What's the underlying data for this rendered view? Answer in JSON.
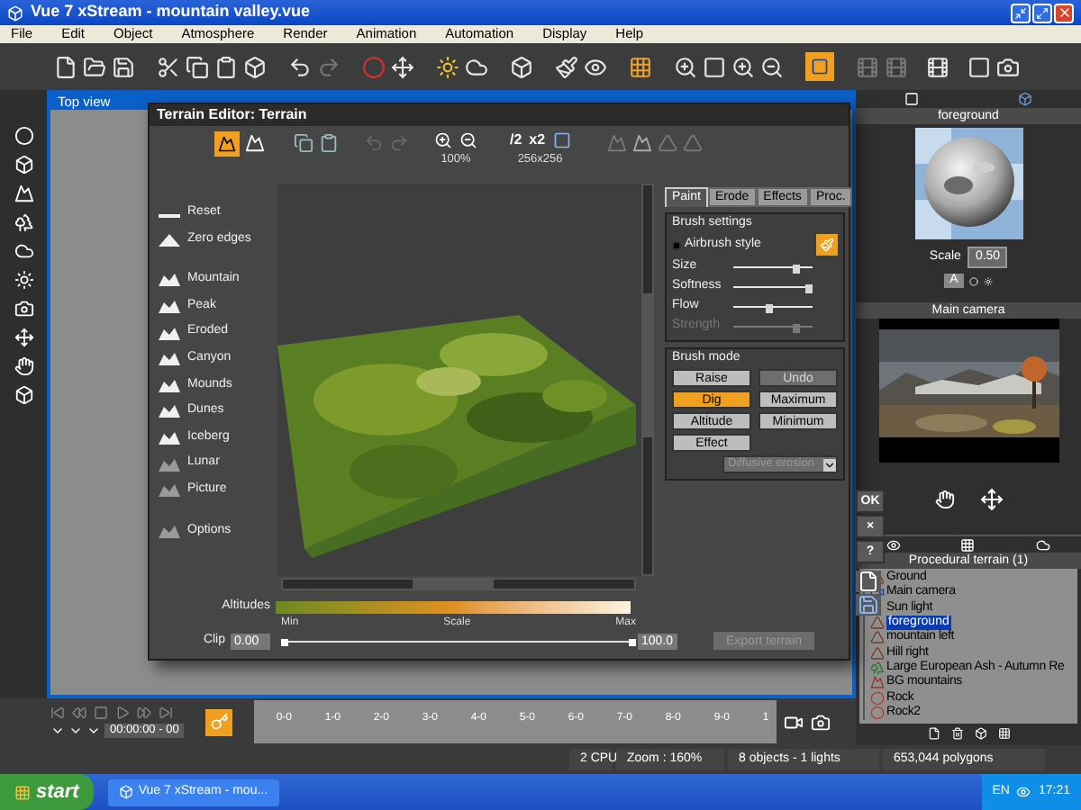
{
  "window": {
    "title": "Vue 7 xStream - mountain valley.vue"
  },
  "menu": [
    "File",
    "Edit",
    "Object",
    "Atmosphere",
    "Render",
    "Animation",
    "Automation",
    "Display",
    "Help"
  ],
  "viewport": {
    "title": "Top view"
  },
  "terrain_editor": {
    "title": "Terrain Editor: Terrain",
    "zoom": "100%",
    "halve": "/2",
    "double": "x2",
    "resolution": "256x256",
    "presets": [
      {
        "label": "Reset",
        "kind": "flat"
      },
      {
        "label": "Zero edges",
        "kind": "peak"
      },
      {
        "label": "Mountain",
        "kind": "mountain"
      },
      {
        "label": "Peak",
        "kind": "mountain"
      },
      {
        "label": "Eroded",
        "kind": "mountain"
      },
      {
        "label": "Canyon",
        "kind": "mountain"
      },
      {
        "label": "Mounds",
        "kind": "mountain"
      },
      {
        "label": "Dunes",
        "kind": "mountain"
      },
      {
        "label": "Iceberg",
        "kind": "mountain"
      },
      {
        "label": "Lunar",
        "kind": "faint"
      },
      {
        "label": "Picture",
        "kind": "faint"
      },
      {
        "label": "Options",
        "kind": "faint"
      }
    ],
    "tabs": [
      {
        "label": "Paint",
        "selected": true
      },
      {
        "label": "Erode",
        "selected": false
      },
      {
        "label": "Effects",
        "selected": false
      },
      {
        "label": "Proc.",
        "selected": false
      }
    ],
    "brush_settings": {
      "title": "Brush settings",
      "airbrush": {
        "label": "Airbrush style",
        "checked": true
      },
      "sliders": [
        {
          "label": "Size",
          "level": 0.85,
          "disabled": false
        },
        {
          "label": "Softness",
          "level": 1,
          "disabled": false
        },
        {
          "label": "Flow",
          "level": 0.5,
          "disabled": false
        },
        {
          "label": "Strength",
          "level": 0.85,
          "disabled": true
        }
      ]
    },
    "brush_mode": {
      "title": "Brush mode",
      "buttons": [
        {
          "label": "Raise",
          "selected": false,
          "disabled": false
        },
        {
          "label": "Undo",
          "selected": false,
          "disabled": true
        },
        {
          "label": "Dig",
          "selected": true,
          "disabled": false
        },
        {
          "label": "Maximum",
          "selected": false,
          "disabled": false
        },
        {
          "label": "Altitude",
          "selected": false,
          "disabled": false
        },
        {
          "label": "Minimum",
          "selected": false,
          "disabled": false
        },
        {
          "label": "Effect",
          "selected": false,
          "disabled": false
        }
      ],
      "dropdown": {
        "value": "Diffusive erosion",
        "disabled": true
      }
    },
    "altitudes_label": "Altitudes",
    "scale_labels": [
      "Min",
      "Scale",
      "Max"
    ],
    "clip": {
      "label": "Clip",
      "min": "0.00",
      "max": "100.0",
      "handles": [
        {
          "level": 0
        },
        {
          "level": 1
        }
      ]
    },
    "export": {
      "label": "Export terrain",
      "disabled": true
    },
    "dialog_buttons": [
      "OK",
      "×",
      "?"
    ]
  },
  "material": {
    "title": "foreground",
    "scale_label": "Scale",
    "scale": "0.50",
    "mode": "A"
  },
  "camera": {
    "title": "Main camera"
  },
  "objects": {
    "title": "Procedural terrain (1)",
    "items": [
      {
        "label": "Ground",
        "kind": "terrain",
        "selected": false
      },
      {
        "label": "Main camera",
        "kind": "camera",
        "selected": false
      },
      {
        "label": "Sun light",
        "kind": "light",
        "selected": false
      },
      {
        "label": "foreground",
        "kind": "terrain",
        "selected": true
      },
      {
        "label": "mountain left",
        "kind": "terrain",
        "selected": false
      },
      {
        "label": "Hill right",
        "kind": "terrain",
        "selected": false
      },
      {
        "label": "Large European Ash  - Autumn Re",
        "kind": "tree",
        "selected": false
      },
      {
        "label": "BG mountains",
        "kind": "mountains",
        "selected": false
      },
      {
        "label": "Rock",
        "kind": "rock",
        "selected": false
      },
      {
        "label": "Rock2",
        "kind": "rock",
        "selected": false
      }
    ]
  },
  "timeline": {
    "time": "00:00:00 - 00",
    "ticks": [
      "0-0",
      "1-0",
      "2-0",
      "3-0",
      "4-0",
      "5-0",
      "6-0",
      "7-0",
      "8-0",
      "9-0",
      "1"
    ]
  },
  "status_bar": [
    "2 CPU",
    "Zoom : 160%",
    "8 objects - 1 lights",
    "653,044 polygons"
  ],
  "taskbar": {
    "start": "start",
    "task": "Vue 7 xStream - mou...",
    "language": "EN",
    "clock": "17:21"
  }
}
